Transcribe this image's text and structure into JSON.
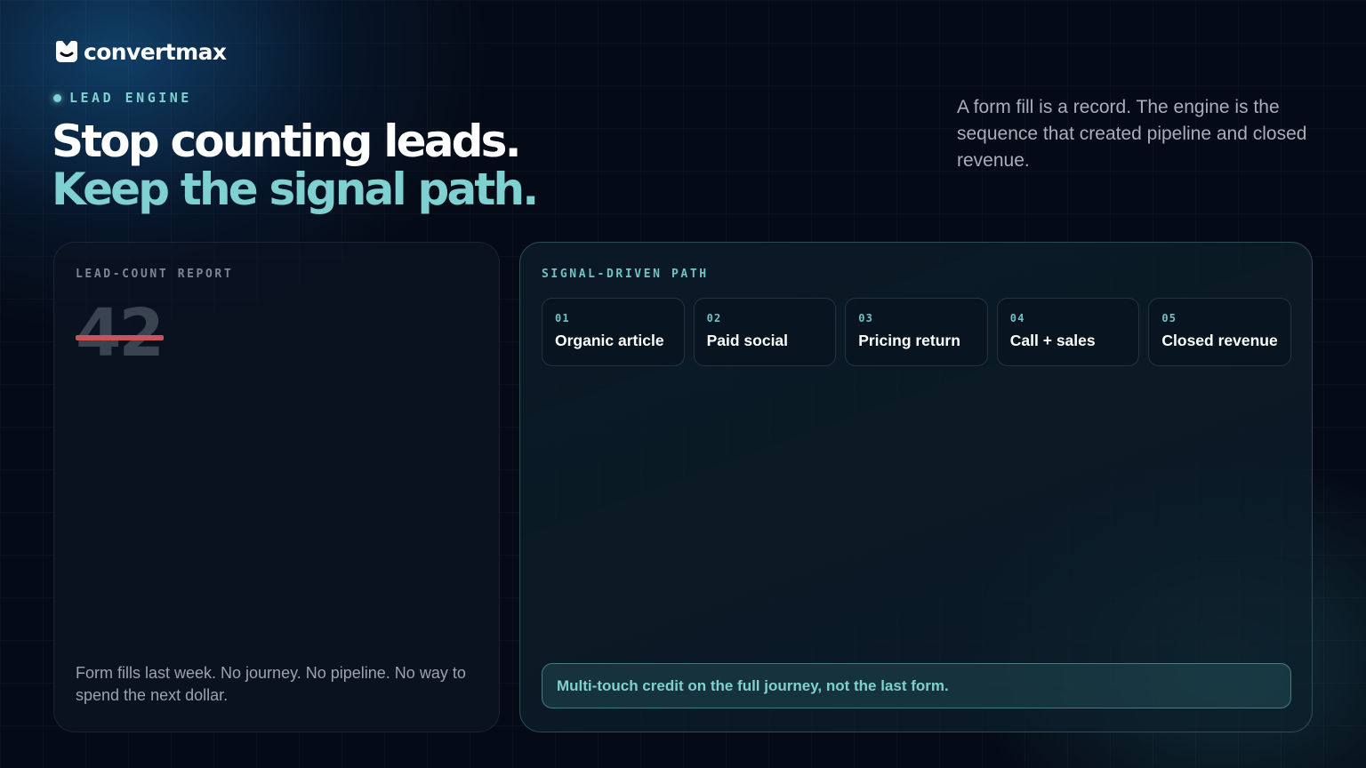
{
  "brand": {
    "logo_text": "convertmax",
    "logo_icon": "convertmax-logo-icon",
    "accent_color": "#7fd0d0"
  },
  "eyebrow": {
    "text": "LEAD ENGINE"
  },
  "headline": {
    "line1": "Stop counting leads.",
    "line2": "Keep the signal path."
  },
  "intro": {
    "text": "A form fill is a record. The engine is the sequence that created pipeline and closed revenue."
  },
  "lead_count_card": {
    "label": "LEAD-COUNT REPORT",
    "number": "42",
    "strike_color": "#c95357",
    "footnote": "Form fills last week. No journey. No pipeline. No way to spend the next dollar."
  },
  "signal_card": {
    "label": "SIGNAL-DRIVEN PATH",
    "steps": [
      {
        "num": "01",
        "label": "Organic article"
      },
      {
        "num": "02",
        "label": "Paid social"
      },
      {
        "num": "03",
        "label": "Pricing return"
      },
      {
        "num": "04",
        "label": "Call + sales"
      },
      {
        "num": "05",
        "label": "Closed revenue"
      }
    ],
    "callout": "Multi-touch credit on the full journey, not the last form."
  }
}
